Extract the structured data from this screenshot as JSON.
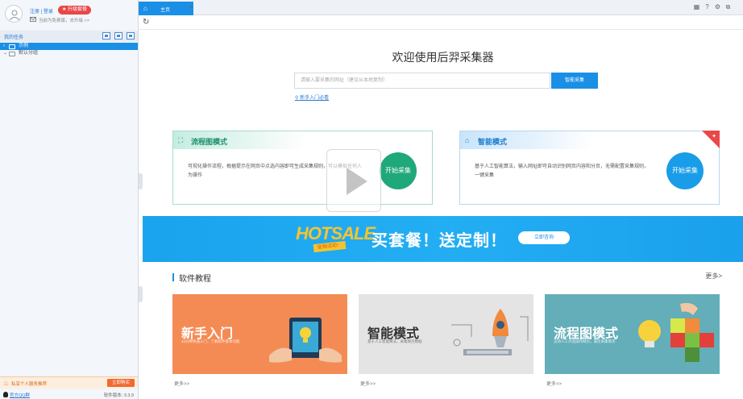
{
  "sidebar": {
    "login_link": "注册 | 登录",
    "upgrade_label": "升级套餐",
    "member_info": "当前为免费版，去升级 >>",
    "task_title": "我的任务",
    "tree": [
      {
        "label": "示例"
      },
      {
        "label": "默认分组"
      }
    ],
    "promo_text": "私享个人服务推荐",
    "promo_button": "立即购买",
    "qq_group": "官方QQ群",
    "version": "软件版本: 3.3.9"
  },
  "tabs": {
    "home_label": "主页",
    "new_tab": "+"
  },
  "window": {
    "icons": [
      "grid-icon",
      "help-icon",
      "settings-icon",
      "restore-icon"
    ]
  },
  "main": {
    "welcome": "欢迎使用后羿采集器",
    "url_placeholder": "请输入要采集的网址（建议从本地复制）",
    "smart_button": "智能采集",
    "guide_link": "新手入门必看",
    "flow_mode": {
      "title": "流程图模式",
      "desc": "可视化操作流程，根据提示在网页中点选内容即可生成采集规则，可以模拟任何人为操作",
      "start": "开始采集"
    },
    "smart_mode": {
      "title": "智能模式",
      "desc": "基于人工智能算法，输入网址即可自动识别网页内容和分页，无需配置采集规则，一键采集",
      "start": "开始采集"
    },
    "banner": {
      "hot": "HOTSALE",
      "tag": "促销活动！",
      "text": "买套餐！送定制！",
      "button": "立即咨询"
    },
    "tutorials": {
      "title": "软件教程",
      "more": "更多>",
      "cards": [
        {
          "title": "新手入门",
          "sub": "10分钟快速入门，了解软件基本功能",
          "more": "更多>>"
        },
        {
          "title": "智能模式",
          "sub": "基于人工智能算法，采集网页数据",
          "more": "更多>>"
        },
        {
          "title": "流程图模式",
          "sub": "支持人工点选操作网页，满足采集需求",
          "more": "更多>>"
        }
      ]
    }
  },
  "colors": {
    "accent": "#1a8fe6",
    "flow_green": "#1fa879",
    "upgrade_red": "#e94848",
    "banner_blue": "#1aa3ee",
    "tut_orange": "#f58b54",
    "tut_gray": "#e4e4e4",
    "tut_teal": "#63aeb8"
  }
}
